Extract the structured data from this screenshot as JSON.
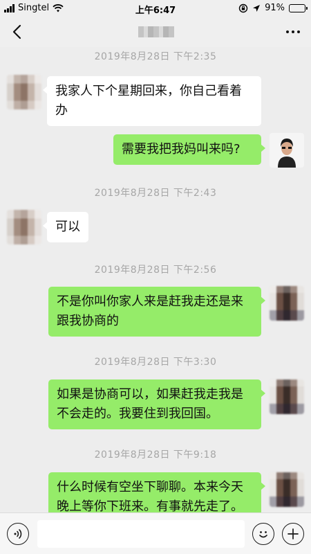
{
  "status_bar": {
    "carrier": "Singtel",
    "time": "上午6:47",
    "battery": "91%",
    "battery_level": 0.91
  },
  "nav": {
    "title_blurred": true,
    "back_icon": "chevron-left-icon",
    "more_icon": "more-horizontal-icon"
  },
  "messages": [
    {
      "time": "2019年8月28日 下午2:35"
    },
    {
      "side": "in",
      "text": "我家人下个星期回来，你自己看着办"
    },
    {
      "side": "out",
      "text": "需要我把我妈叫来吗?"
    },
    {
      "time": "2019年8月28日 下午2:43"
    },
    {
      "side": "in",
      "text": "可以"
    },
    {
      "time": "2019年8月28日 下午2:56"
    },
    {
      "side": "out",
      "text": "不是你叫你家人来是赶我走还是来跟我协商的"
    },
    {
      "time": "2019年8月28日 下午3:30"
    },
    {
      "side": "out",
      "text": "如果是协商可以，如果赶我走我是不会走的。我要住到我回国。"
    },
    {
      "time": "2019年8月28日 下午9:18"
    },
    {
      "side": "out",
      "text": "什么时候有空坐下聊聊。本来今天晚上等你下班来。有事就先走了。"
    }
  ],
  "input_bar": {
    "voice_icon": "voice-icon",
    "emoji_icon": "emoji-icon",
    "plus_icon": "plus-icon",
    "placeholder": ""
  },
  "colors": {
    "background": "#ededed",
    "bubble_out": "#95ec69",
    "bubble_in": "#ffffff",
    "timestamp": "#a6a6a6"
  }
}
